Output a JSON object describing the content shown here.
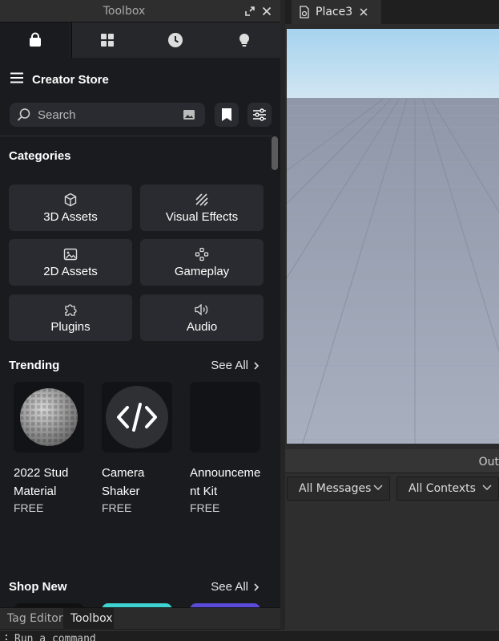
{
  "toolbox": {
    "title": "Toolbox",
    "store_title": "Creator Store",
    "search_placeholder": "Search",
    "categories_title": "Categories",
    "categories": [
      {
        "label": "3D Assets",
        "icon": "cube-icon"
      },
      {
        "label": "Visual Effects",
        "icon": "stripes-icon"
      },
      {
        "label": "2D Assets",
        "icon": "image-icon"
      },
      {
        "label": "Gameplay",
        "icon": "gamepad-icon"
      },
      {
        "label": "Plugins",
        "icon": "puzzle-icon"
      },
      {
        "label": "Audio",
        "icon": "speaker-icon"
      }
    ],
    "trending_title": "Trending",
    "see_all": "See All",
    "trending": [
      {
        "name": "2022 Stud Material",
        "price": "FREE"
      },
      {
        "name": "Camera Shaker",
        "price": "FREE"
      },
      {
        "name": "Announcement Kit",
        "price": "FREE"
      }
    ],
    "shop_new_title": "Shop New",
    "shop_new_see_all": "See All",
    "accent": "#3b82f6"
  },
  "bottom_tabs": [
    "Tag Editor",
    "Toolbox"
  ],
  "document_tab": "Place3",
  "output": {
    "title": "Out",
    "filter_messages": "All Messages",
    "filter_contexts": "All Contexts"
  },
  "command_bar": {
    "prompt": ":",
    "placeholder": "Run a command"
  }
}
